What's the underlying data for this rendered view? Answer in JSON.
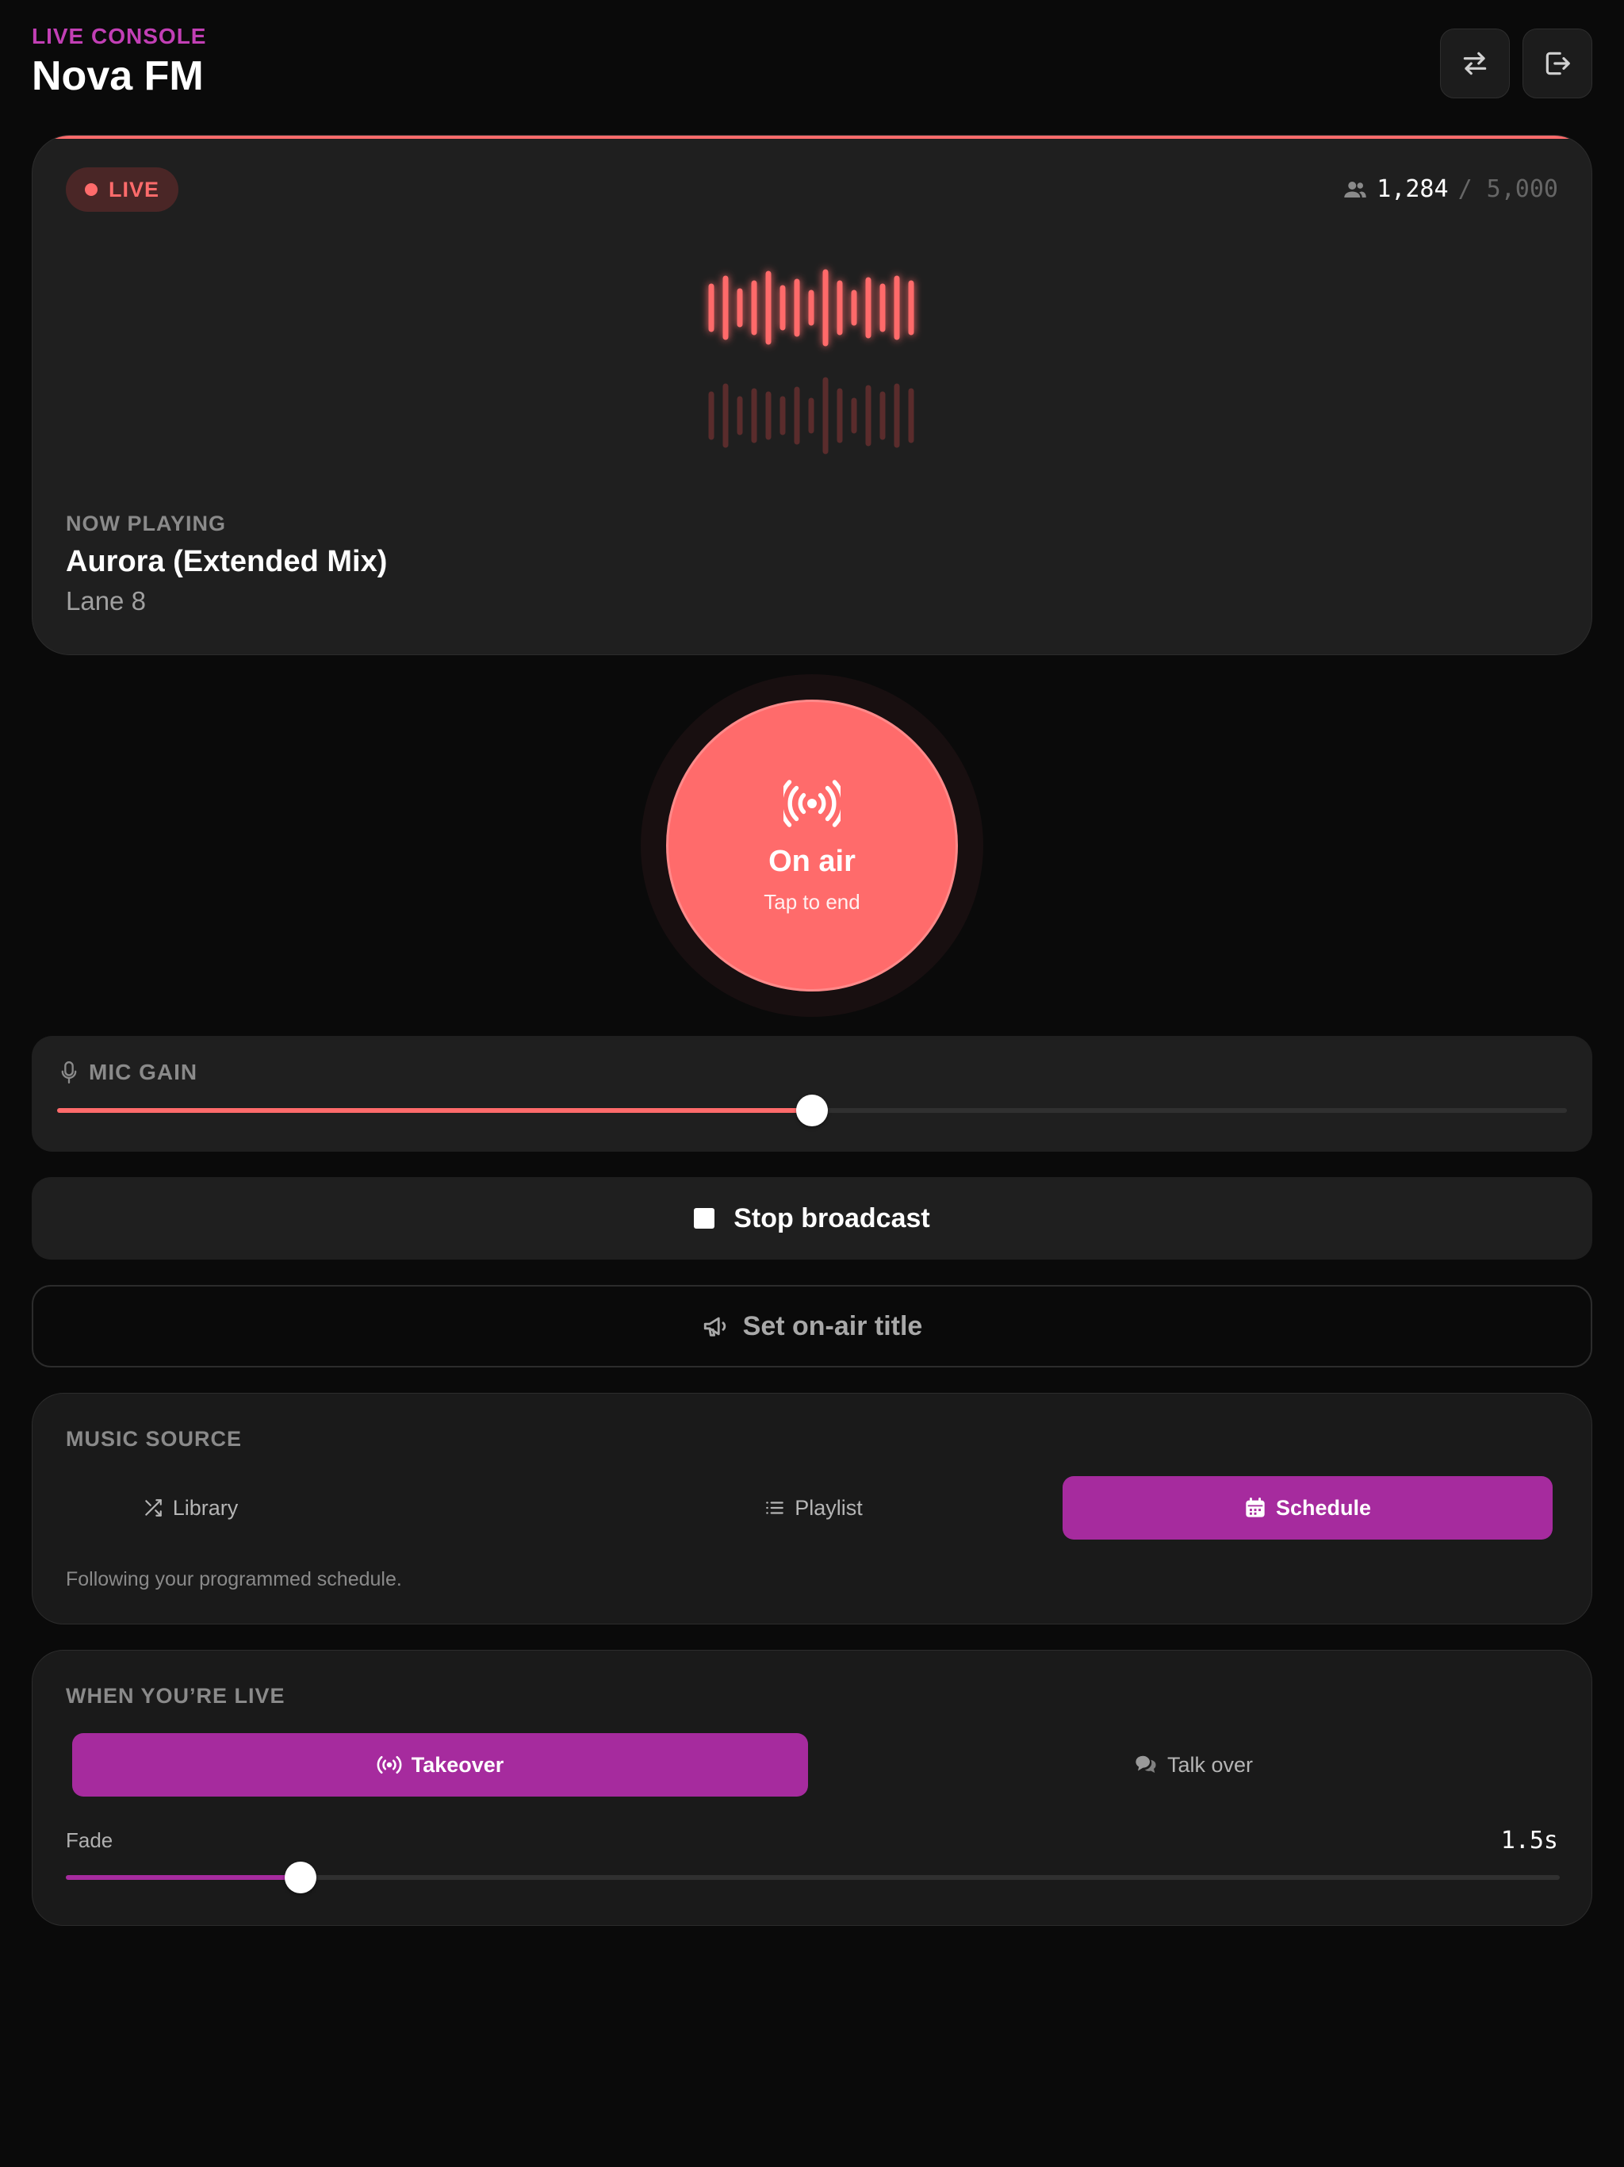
{
  "header": {
    "eyebrow": "LIVE CONSOLE",
    "station": "Nova FM",
    "buttons": [
      {
        "icon": "swap-icon"
      },
      {
        "icon": "logout-icon"
      }
    ]
  },
  "now_playing": {
    "status": "LIVE",
    "listeners_current": "1,284",
    "listeners_max": "/ 5,000",
    "label": "NOW PLAYING",
    "track": "Aurora (Extended Mix)",
    "artist": "Lane 8",
    "accent": "#ff6b6b"
  },
  "onair": {
    "label": "On air",
    "sub": "Tap to end",
    "icon": "broadcast-icon",
    "color": "#ff6b6b"
  },
  "mic": {
    "label": "MIC GAIN",
    "icon": "microphone-icon",
    "level_percent": 50
  },
  "actions": {
    "stop_label": "Stop broadcast",
    "title_label": "Set on-air title"
  },
  "music_source": {
    "label": "MUSIC SOURCE",
    "options": [
      {
        "label": "Library",
        "icon": "shuffle-icon",
        "active": false
      },
      {
        "label": "Playlist",
        "icon": "list-icon",
        "active": false
      },
      {
        "label": "Schedule",
        "icon": "calendar-icon",
        "active": true
      }
    ],
    "note": "Following your programmed schedule.",
    "accent": "#a62b9e"
  },
  "when_live": {
    "label": "WHEN YOU’RE LIVE",
    "options": [
      {
        "label": "Takeover",
        "icon": "broadcast-icon",
        "active": true
      },
      {
        "label": "Talk over",
        "icon": "chat-icon",
        "active": false
      }
    ],
    "fade_label": "Fade",
    "fade_value": "1.5s",
    "fade_percent": 15.7
  }
}
